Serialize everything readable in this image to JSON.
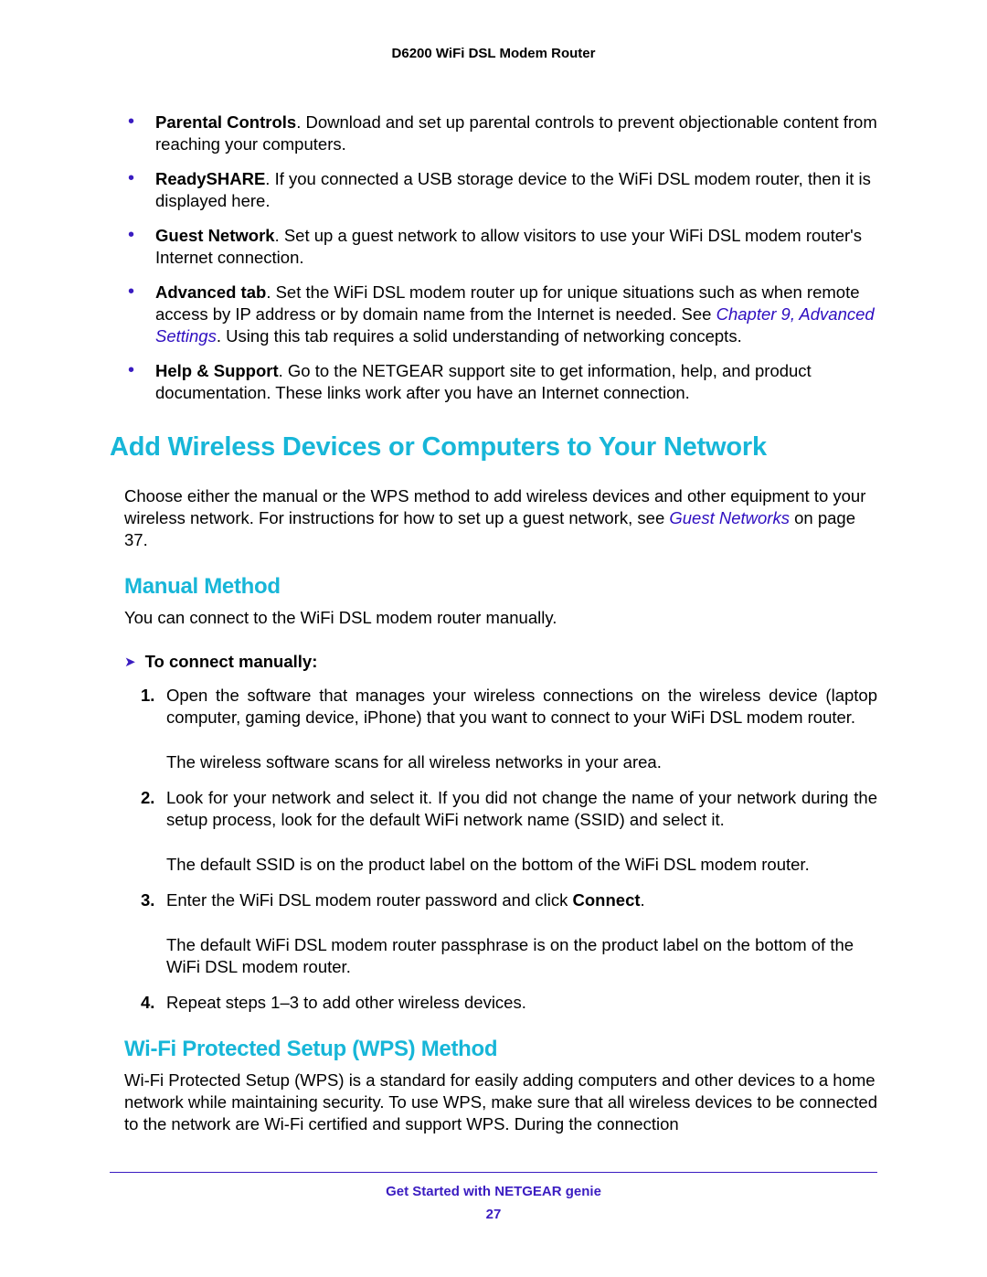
{
  "header": {
    "title": "D6200 WiFi DSL Modem Router"
  },
  "bullets": [
    {
      "bold": "Parental Controls",
      "text": ". Download and set up parental controls to prevent objectionable content from reaching your computers."
    },
    {
      "bold": "ReadySHARE",
      "text": ". If you connected a USB storage device to the WiFi DSL modem router, then it is displayed here."
    },
    {
      "bold": "Guest Network",
      "text": ". Set up a guest network to allow visitors to use your WiFi DSL modem router's Internet connection."
    },
    {
      "bold": "Advanced tab",
      "pre": ". Set the WiFi DSL modem router up for unique situations such as when remote access by IP address or by domain name from the Internet is needed. See ",
      "link": "Chapter 9, Advanced Settings",
      "post": ". Using this tab requires a solid understanding of networking concepts."
    },
    {
      "bold": "Help & Support",
      "text": ". Go to the NETGEAR support site to get information, help, and product documentation. These links work after you have an Internet connection."
    }
  ],
  "section1": {
    "title": "Add Wireless Devices or Computers to Your Network",
    "intro_pre": "Choose either the manual or the WPS method to add wireless devices and other equipment to your wireless network. For instructions for how to set up a guest network, see ",
    "intro_link": "Guest Networks",
    "intro_post": " on page 37."
  },
  "manual": {
    "title": "Manual Method",
    "intro": "You can connect to the WiFi DSL modem router manually.",
    "procedure_label": "To connect manually:",
    "steps": {
      "s1": "Open the software that manages your wireless connections on the wireless device (laptop computer, gaming device, iPhone) that you want to connect to your WiFi DSL modem router.",
      "s1b": "The wireless software scans for all wireless networks in your area.",
      "s2": "Look for your network and select it. If you did not change the name of your network during the setup process, look for the default WiFi network name (SSID) and select it.",
      "s2b": "The default SSID is on the product label on the bottom of the WiFi DSL modem router.",
      "s3_pre": "Enter the WiFi DSL modem router password and click ",
      "s3_bold": "Connect",
      "s3_post": ".",
      "s3b": "The default WiFi DSL modem router passphrase is on the product label on the bottom of the WiFi DSL modem router.",
      "s4": "Repeat steps 1–3 to add other wireless devices."
    },
    "nums": {
      "n1": "1.",
      "n2": "2.",
      "n3": "3.",
      "n4": "4."
    }
  },
  "wps": {
    "title": "Wi-Fi Protected Setup (WPS) Method",
    "intro": "Wi-Fi Protected Setup (WPS) is a standard for easily adding computers and other devices to a home network while maintaining security. To use WPS, make sure that all wireless devices to be connected to the network are Wi-Fi certified and support WPS. During the connection"
  },
  "footer": {
    "text": "Get Started with NETGEAR genie",
    "page": "27"
  }
}
